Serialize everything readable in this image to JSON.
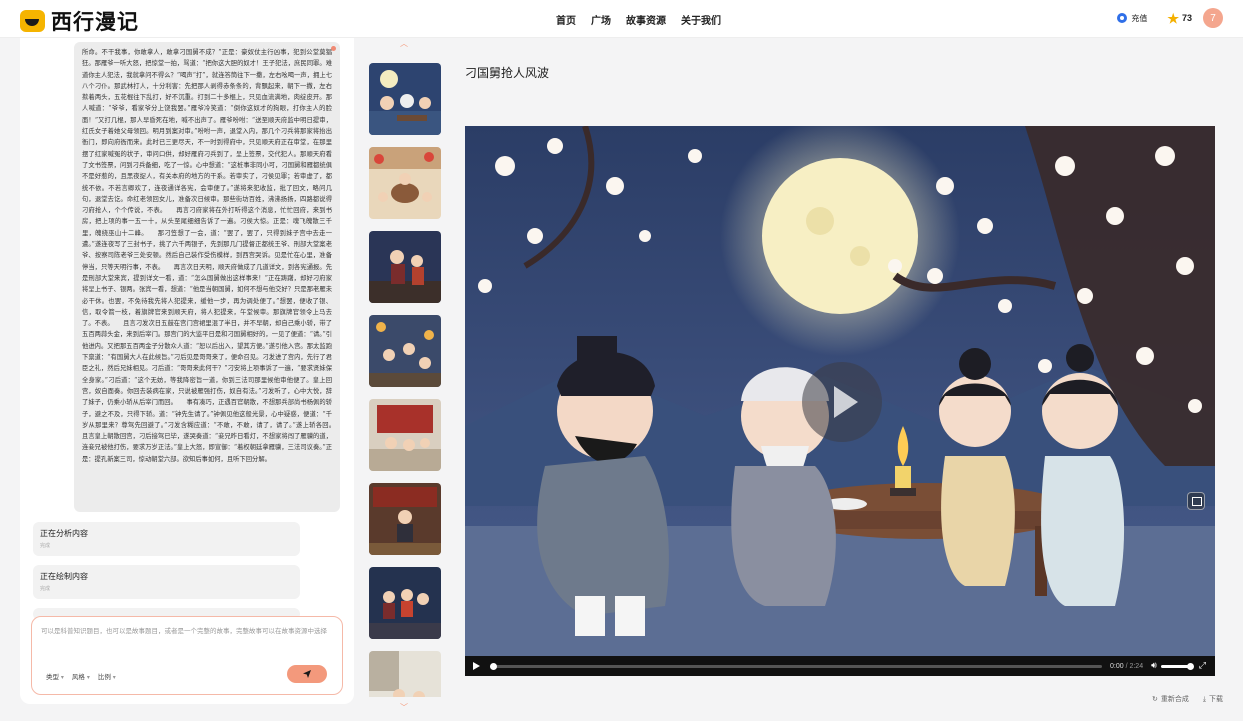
{
  "header": {
    "logo_text": "西行漫记",
    "nav": [
      "首页",
      "广场",
      "故事资源",
      "关于我们"
    ],
    "recharge_label": "充值",
    "coins": "73",
    "avatar_letter": "7"
  },
  "left": {
    "story_text": "所命。不干我事，你敢拿人，敢拿刁国舅不成？”正是：豪奴仗主行凶事，犯到公堂莫猖狂。那雁爷一听大怒，把惊堂一拍，骂道：“把你这大胆的奴才！王子犯法，庶民同罪。难道你主人犯法，我就拿问不得么？”喝声“打”，就连答筒往下一撒，左右吆喝一声，拥上七八个刁仆。那武林打人，十分利害：先把那人剥得赤条条的，背飘起来，朝下一撒，左右揿着两头，五花棍往下乱打，好不沉重。打到二十多棍上，只见血流满地，肉绽皮开。那人喊道：“爷爷，看家爷分上饶我罢。”雁爷冷笑道：“倒你这奴才的狗眼，打你主人的脸面！”又打几棍，那人早昏死在地，喊不出声了。雁爷吩咐：“送至顺天府监中明日提审，红氏女子着她父母领回。明月到案对审。”吩咐一声，退堂入内，那几个刁兵将那家将抬出衙门，即向府衙而来。此时已三更尽天，不一时到得府中，只见顺天府正在审堂，在那里摆了红家喊冤的状子，审问口供，却好雁府刁兵到了，呈上签票，交代犯人。那顺天府看了文书签票，问到刁兵备细，吃了一惊。心中想道：“这桩事非同小可，刁国舅和雁都统俱不是好惹的，且黑夜捉人，有关本府的地方的干系。若审实了，刁侯见罪；若审虚了，都统不依。不若言卿欢了，连夜通详各宪，会审便了。”遂将来犯收监，批了回文，略问几句，退堂去讫。命红老领回女儿，准备次日候审。那些街坊百姓，沸沸扬扬，四路都说得刁府抢人，个个传说，不表。　　再言刁府家将在外打听得这个消息，忙忙回府，来到书房，把上项的事一五一十，从头至尾细细告诉了一遍。刁侯大惊。正是：魂飞魄散三千里，魄绕巫山十二峰。　　那刁笠想了一会，道：“罢了，罢了，只得到妹子宫中去走一遭。”遂连夜写了三封书子，挑了六千两银子，先到那几门提督正都统王爷、刑部大堂案老爷、按察司陈老爷三处安顿。然后自己装作受伤模样，到西宫哭诉。见是忙在心里，准备停当，只等天明行事，不表。　　再言次日天明，顺天府做成了几道详文，到各宪通报。先是刑部大堂来宾，提到详文一看，道：“怎么国舅做出这样事来！”正在踌躇，却好刁府家将呈上书子、银两。张宾一看，想道：“他是当朝国舅，如何不想与他交好？只是那老雁未必干休。也罢，不免待我先将人犯提来，缓他一步，再为调处便了。”想罢，便收了银、信，取令箭一枝，着旗牌官来到顺天府，将人犯提来，午堂候审。那旗牌官领令上马去了。不表。　　且言刁发次日五鼓在宫门宫裙里混了半日，并不早朝，却自己乘小轿，带了五百两蒜头金，来到后宰门。那宫门的大监平日是和刁国舅相好的，一见了便道：“请。”引他进内。又把那五百两金子分散众人道：“恕以后出入，望其方便。”遂引他入宫。那太监跑下禀道：“有国舅大人在此候旨。”刁后见是哥哥来了，便命召见。刁发进了宫内，先行了君臣之礼，然后兄妹相见。刁后道：“哥哥来此何干？”刁安将上项事诉了一遍，“要求贤妹保全身家。”刁后道：“这个无妨，等我降密旨一道，你到三法司那里候他审他便了。皇上回宫，奴自面奏。你回去装病在家，只说被雁强打伤，奴自有法。”刁发听了，心中大悦，辞了妹子，仍乘小轿从后宰门而回。　　事有凑巧，正遇百官朝散，不想那兵部尚书杨佩的轿子，避之不及，只得下轿。道：“钟先生请了。”钟佩见他这般光景，心中疑惑，便道：“千岁从那里来？尊驾先回避了。”刁发含糊应道：“不敢，不敢，请了，请了。”遂上轿各回。　　且言皇上朝散回宫，刁后接驾已毕，遂哭奏道：“妾兄昨日看灯，不想家将闯了雁骥的道，连妾兄被他打伤，要求万岁正法。”皇上大怒，即宣御：“着权朝廷拿雁骥，三法司议奏。”正是：提孔新案三司，惊动朝堂六部。欲知后事如何，且听下回分解。",
    "status_items": [
      {
        "title": "正在分析内容",
        "sub": "完成"
      },
      {
        "title": "正在绘制内容",
        "sub": "完成"
      }
    ],
    "input_placeholder": "可以是科普知识题目，也可以是故事题目，或者是一个完整的故事，完整故事可以在故事资源中选择",
    "selectors": [
      "类型",
      "风格",
      "比例"
    ]
  },
  "main": {
    "title": "刁国舅抢人风波",
    "time_current": "0:00",
    "time_total": "/ 2:24",
    "progress": 0
  },
  "actions": {
    "regen": "重新合成",
    "download": "下载"
  },
  "colors": {
    "accent": "#f3997c",
    "brand_yellow": "#f5b400"
  }
}
